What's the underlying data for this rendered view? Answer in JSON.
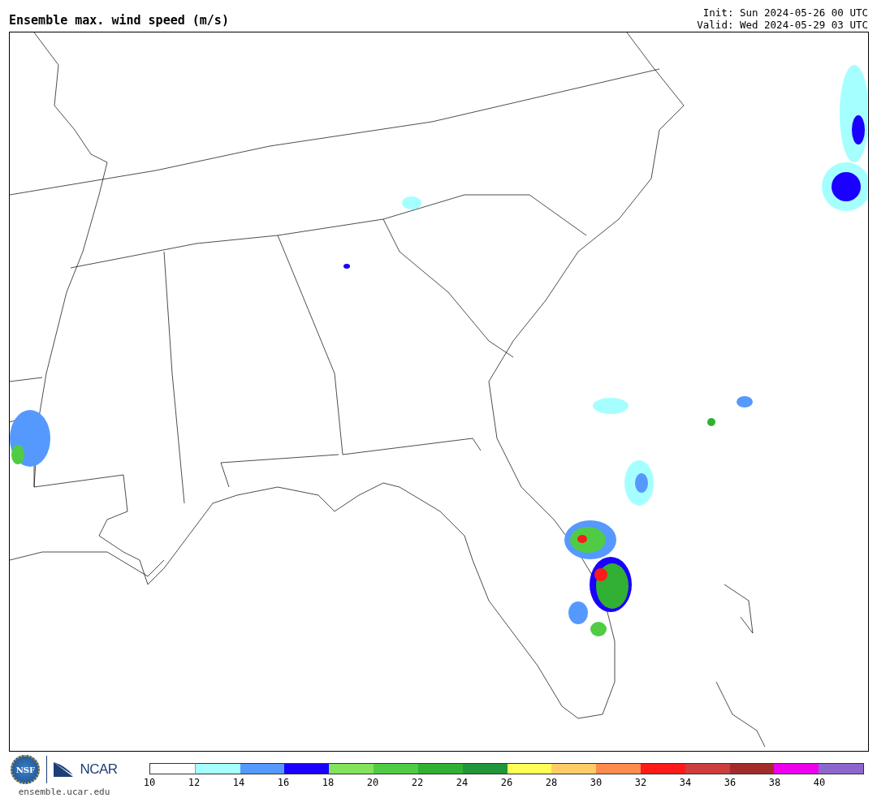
{
  "title": "Ensemble max. wind speed (m/s)",
  "init": "Init: Sun 2024-05-26 00 UTC",
  "valid": "Valid: Wed 2024-05-29 03 UTC",
  "footer": {
    "nsf_logo": "NSF",
    "ncar_logo": "NCAR",
    "url": "ensemble.ucar.edu"
  },
  "colorbar": [
    {
      "label": "10",
      "color": "#ffffff"
    },
    {
      "label": "12",
      "color": "#a6ffff"
    },
    {
      "label": "14",
      "color": "#5599ff"
    },
    {
      "label": "16",
      "color": "#1a00ff"
    },
    {
      "label": "18",
      "color": "#82e35c"
    },
    {
      "label": "20",
      "color": "#4fcc44"
    },
    {
      "label": "22",
      "color": "#31b033"
    },
    {
      "label": "24",
      "color": "#21963a"
    },
    {
      "label": "26",
      "color": "#ffff55"
    },
    {
      "label": "28",
      "color": "#ffcc66"
    },
    {
      "label": "30",
      "color": "#ff8a4d"
    },
    {
      "label": "32",
      "color": "#ff1a1a"
    },
    {
      "label": "34",
      "color": "#cc3d3d"
    },
    {
      "label": "36",
      "color": "#a32b2b"
    },
    {
      "label": "38",
      "color": "#ee00ee"
    },
    {
      "label": "40",
      "color": "#8c66cc"
    }
  ]
}
